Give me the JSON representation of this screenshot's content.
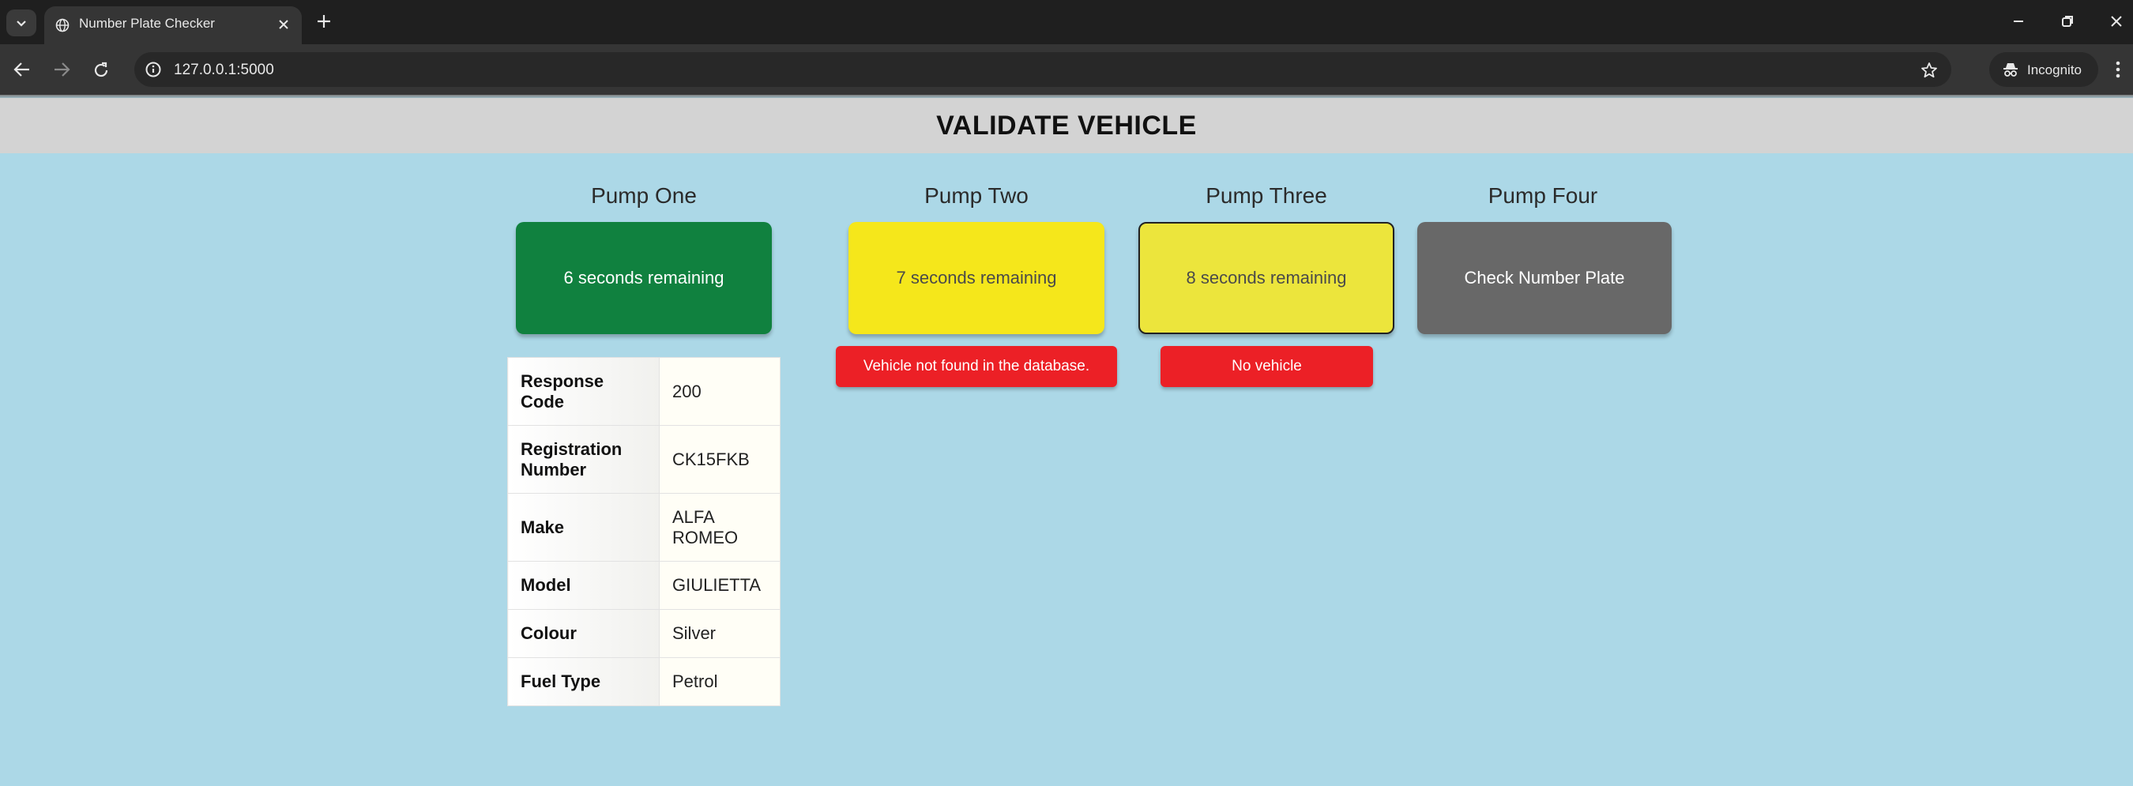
{
  "browser": {
    "tab_title": "Number Plate Checker",
    "url": "127.0.0.1:5000",
    "incognito_label": "Incognito"
  },
  "page": {
    "title": "VALIDATE VEHICLE"
  },
  "pumps": [
    {
      "title": "Pump One",
      "button_label": "6 seconds remaining",
      "color": "#10813f"
    },
    {
      "title": "Pump Two",
      "button_label": "7 seconds remaining",
      "message": "Vehicle not found in the database.",
      "color": "#f5e71b"
    },
    {
      "title": "Pump Three",
      "button_label": "8 seconds remaining",
      "message": "No vehicle",
      "color": "#ece53c"
    },
    {
      "title": "Pump Four",
      "button_label": "Check Number Plate",
      "color": "#686868"
    }
  ],
  "vehicle_details": [
    {
      "label": "Response Code",
      "value": "200"
    },
    {
      "label": "Registration Number",
      "value": "CK15FKB"
    },
    {
      "label": "Make",
      "value": "ALFA ROMEO"
    },
    {
      "label": "Model",
      "value": "GIULIETTA"
    },
    {
      "label": "Colour",
      "value": "Silver"
    },
    {
      "label": "Fuel Type",
      "value": "Petrol"
    }
  ],
  "colors": {
    "page_background": "#acd8e7",
    "header_background": "#d3d3d3",
    "error_red": "#ec2026"
  }
}
